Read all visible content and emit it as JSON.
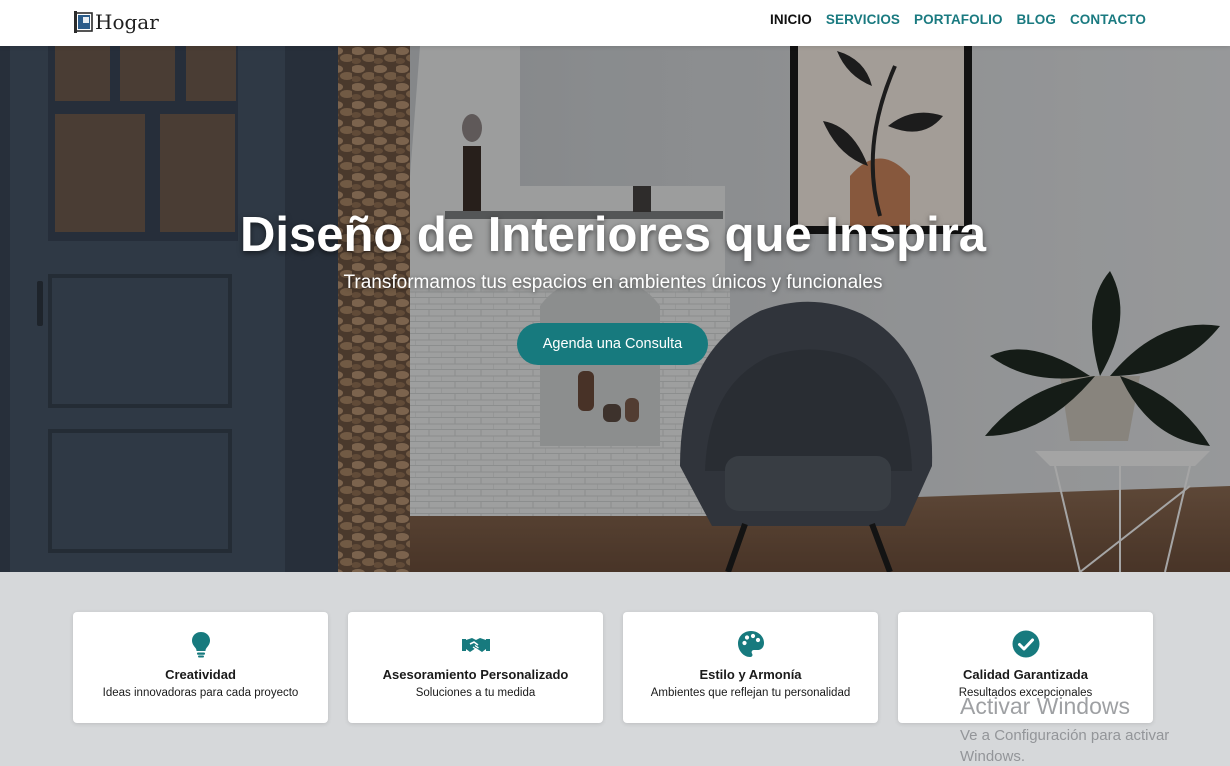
{
  "brand": {
    "name": "Hogar"
  },
  "nav": {
    "items": [
      {
        "label": "INICIO",
        "active": true
      },
      {
        "label": "SERVICIOS",
        "active": false
      },
      {
        "label": "PORTAFOLIO",
        "active": false
      },
      {
        "label": "BLOG",
        "active": false
      },
      {
        "label": "CONTACTO",
        "active": false
      }
    ]
  },
  "hero": {
    "title": "Diseño de Interiores que Inspira",
    "subtitle": "Transformamos tus espacios en ambientes únicos y funcionales",
    "cta_label": "Agenda una Consulta"
  },
  "features": [
    {
      "icon": "lightbulb-icon",
      "title": "Creatividad",
      "desc": "Ideas innovadoras para cada proyecto"
    },
    {
      "icon": "handshake-icon",
      "title": "Asesoramiento Personalizado",
      "desc": "Soluciones a tu medida"
    },
    {
      "icon": "palette-icon",
      "title": "Estilo y Armonía",
      "desc": "Ambientes que reflejan tu personalidad"
    },
    {
      "icon": "check-circle-icon",
      "title": "Calidad Garantizada",
      "desc": "Resultados excepcionales"
    }
  ],
  "watermark": {
    "line1": "Activar Windows",
    "line2": "Ve a Configuración para activar Windows."
  },
  "colors": {
    "accent": "#177a7e",
    "nav_link": "#1a7a80",
    "nav_active": "#111111",
    "section_bg": "#d6d8da"
  }
}
